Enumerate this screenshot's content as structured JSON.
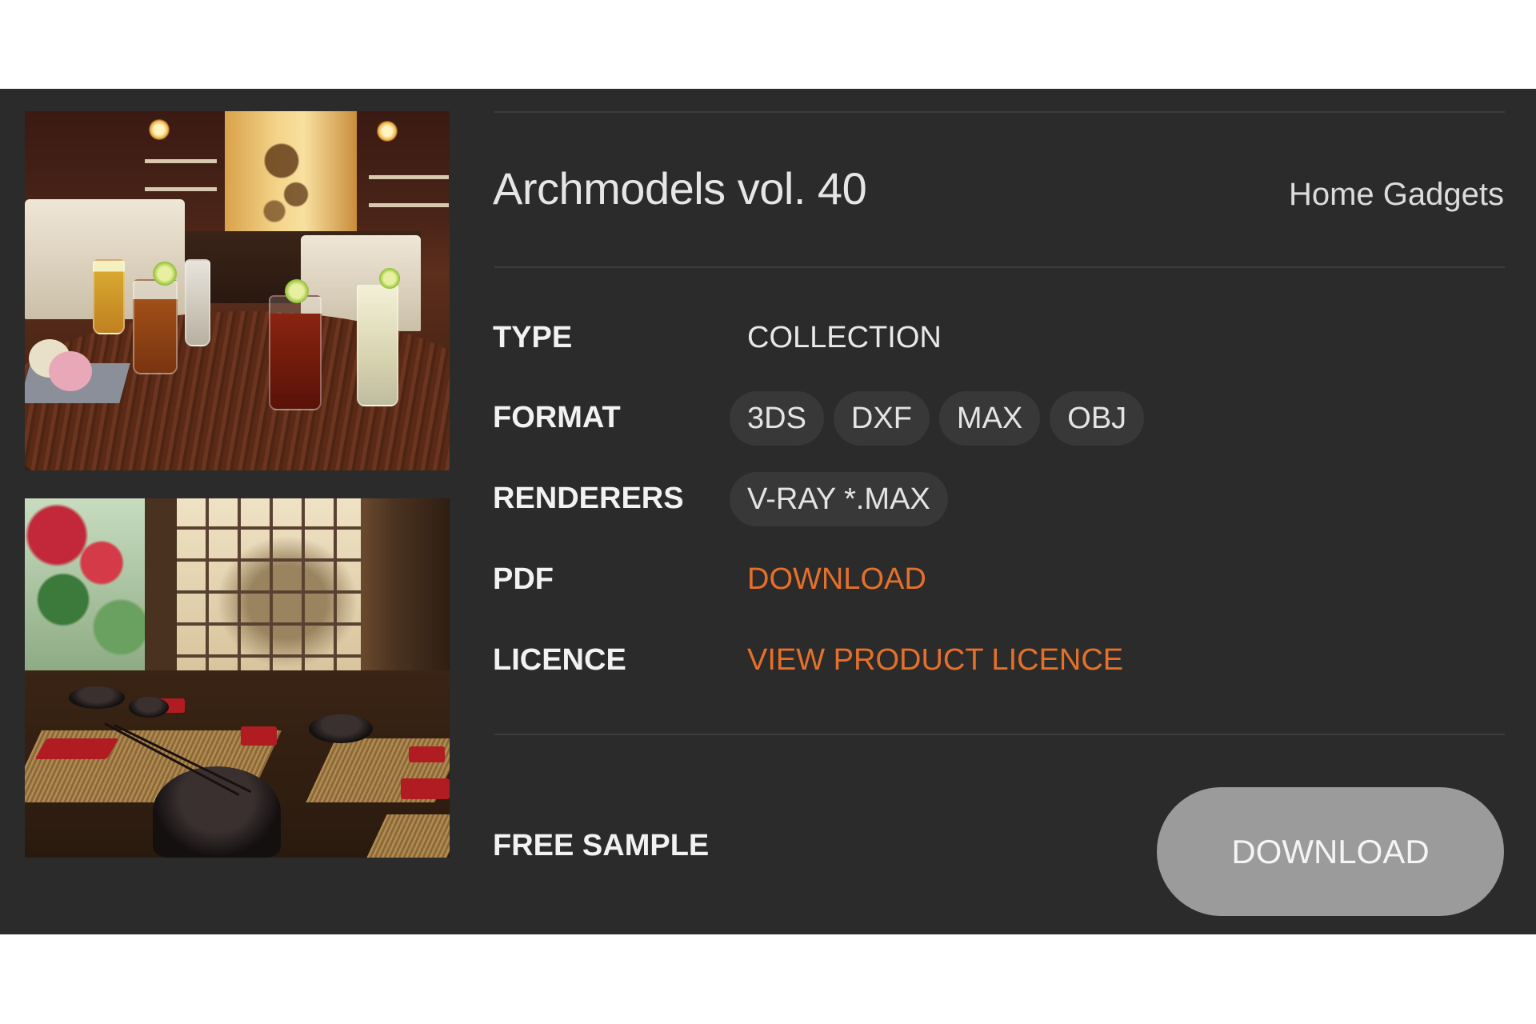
{
  "product": {
    "title": "Archmodels vol. 40",
    "category": "Home Gadgets"
  },
  "details": {
    "type": {
      "label": "TYPE",
      "value": "COLLECTION"
    },
    "format": {
      "label": "FORMAT",
      "values": [
        "3DS",
        "DXF",
        "MAX",
        "OBJ"
      ]
    },
    "renderers": {
      "label": "RENDERERS",
      "values": [
        "V-RAY *.MAX"
      ]
    },
    "pdf": {
      "label": "PDF",
      "link": "DOWNLOAD"
    },
    "licence": {
      "label": "LICENCE",
      "link": "VIEW PRODUCT LICENCE"
    }
  },
  "free_sample": {
    "label": "FREE SAMPLE",
    "button": "DOWNLOAD"
  },
  "colors": {
    "panel_background": "#2b2b2b",
    "accent_link": "#e4702a",
    "button_background": "#9b9b9b"
  }
}
